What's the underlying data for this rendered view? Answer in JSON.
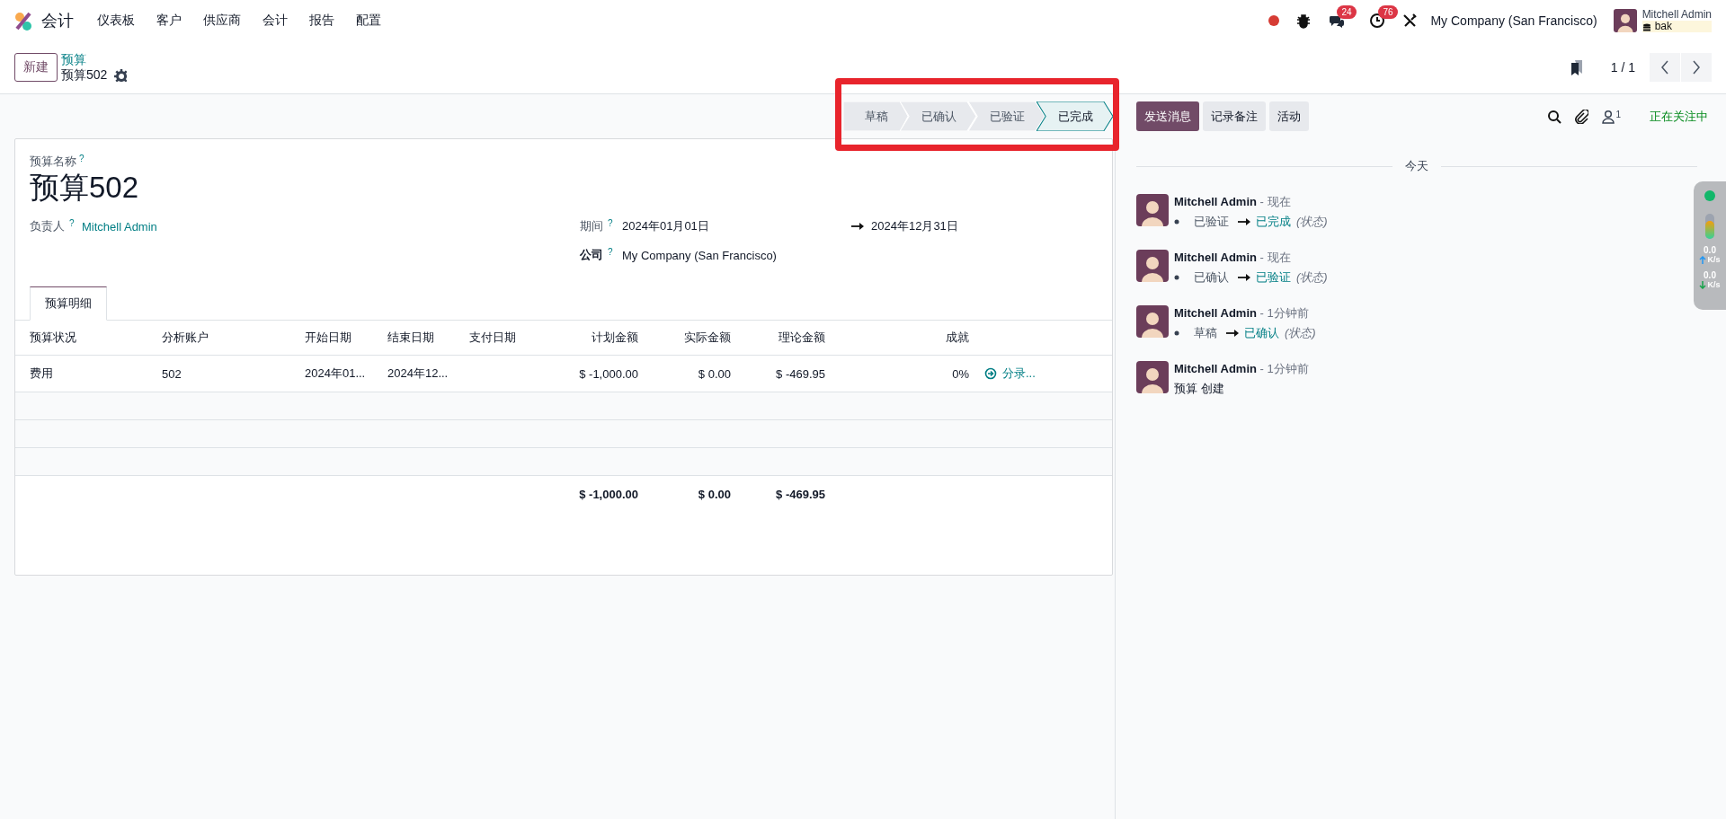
{
  "navbar": {
    "app_name": "会计",
    "menu": [
      "仪表板",
      "客户",
      "供应商",
      "会计",
      "报告",
      "配置"
    ],
    "messages_count": "24",
    "activities_count": "76",
    "company": "My Company (San Francisco)",
    "user": {
      "name": "Mitchell Admin",
      "database": "bak"
    }
  },
  "control_panel": {
    "new_button": "新建",
    "breadcrumb": "预算",
    "record_title": "预算502",
    "pager": "1 / 1"
  },
  "statusbar": {
    "highlighted": true,
    "stages": [
      {
        "label": "草稿",
        "selected": false
      },
      {
        "label": "已确认",
        "selected": false
      },
      {
        "label": "已验证",
        "selected": false
      },
      {
        "label": "已完成",
        "selected": true
      }
    ]
  },
  "form": {
    "name_label": "预算名称",
    "name_help": "?",
    "name": "预算502",
    "responsible": {
      "label": "负责人",
      "help": "?",
      "value": "Mitchell Admin"
    },
    "period": {
      "label": "期间",
      "help": "?",
      "start": "2024年01月01日",
      "end": "2024年12月31日"
    },
    "company": {
      "label": "公司",
      "help": "?",
      "value": "My Company (San Francisco)"
    },
    "tabs": [
      {
        "label": "预算明细",
        "selected": true
      }
    ],
    "table": {
      "columns": [
        "预算状况",
        "分析账户",
        "开始日期",
        "结束日期",
        "支付日期",
        "计划金额",
        "实际金额",
        "理论金额",
        "成就"
      ],
      "rows": [
        {
          "cells": [
            "费用",
            "502",
            "2024年01...",
            "2024年12...",
            null,
            "$ -1,000.00",
            "$ 0.00",
            "$ -469.95",
            "0%"
          ],
          "action": "分录..."
        }
      ],
      "totals": {
        "planned": "$ -1,000.00",
        "actual": "$ 0.00",
        "theoretical": "$ -469.95"
      }
    }
  },
  "chatter": {
    "buttons": [
      {
        "label": "发送消息",
        "primary": true
      },
      {
        "label": "记录备注",
        "primary": false
      },
      {
        "label": "活动",
        "primary": false
      }
    ],
    "follower_count": "1",
    "following": "正在关注中",
    "date_separator": "今天",
    "messages": [
      {
        "kind": "tracking",
        "author": "Mitchell Admin",
        "time": "- 现在",
        "old": "已验证",
        "new": "已完成",
        "field": "(状态)"
      },
      {
        "kind": "tracking",
        "author": "Mitchell Admin",
        "time": "- 现在",
        "old": "已确认",
        "new": "已验证",
        "field": "(状态)"
      },
      {
        "kind": "tracking",
        "author": "Mitchell Admin",
        "time": "- 1分钟前",
        "old": "草稿",
        "new": "已确认",
        "field": "(状态)"
      },
      {
        "kind": "note",
        "author": "Mitchell Admin",
        "time": "- 1分钟前",
        "body": "预算 创建"
      }
    ]
  },
  "net_widget": {
    "upload": "0.0",
    "upload_unit": "K/s",
    "download": "0.0",
    "download_unit": "K/s"
  }
}
